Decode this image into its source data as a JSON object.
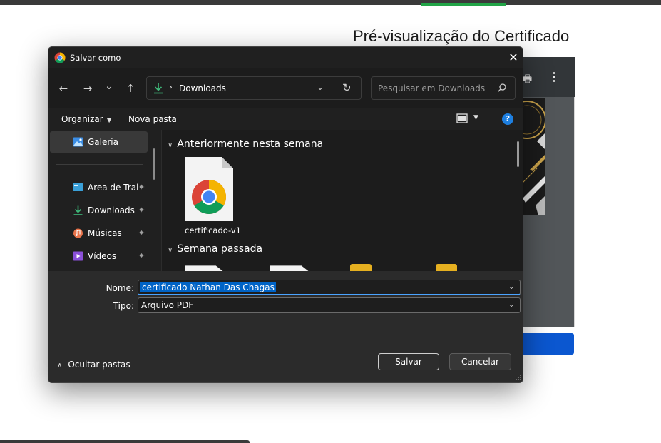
{
  "background_page": {
    "title": "Pré-visualização do Certificado"
  },
  "dialog": {
    "title": "Salvar como",
    "close_symbol": "✕",
    "app_icon": "chrome-icon",
    "nav": {
      "back_symbol": "←",
      "forward_symbol": "→",
      "recent_symbol": "⌄",
      "up_symbol": "↑"
    },
    "address": {
      "separator": "›",
      "location": "Downloads",
      "dropdown_symbol": "⌄",
      "refresh_symbol": "↻"
    },
    "search": {
      "placeholder": "Pesquisar em Downloads"
    },
    "commands": {
      "organize": "Organizar",
      "organize_dd": "▼",
      "new_folder": "Nova pasta",
      "view_dd": "▼",
      "help_symbol": "?"
    },
    "sidebar": {
      "items": [
        {
          "label": "Galeria",
          "icon": "gallery-icon",
          "pinned": false
        },
        {
          "label": "Área de Trabalho",
          "icon": "desktop-icon",
          "pinned": true
        },
        {
          "label": "Downloads",
          "icon": "download-icon",
          "pinned": true
        },
        {
          "label": "Músicas",
          "icon": "music-icon",
          "pinned": true
        },
        {
          "label": "Vídeos",
          "icon": "video-icon",
          "pinned": true
        }
      ],
      "pin_symbol": "📌"
    },
    "content": {
      "groups": [
        {
          "label": "Anteriormente nesta semana",
          "chevron": "∨"
        },
        {
          "label": "Semana passada",
          "chevron": "∨"
        }
      ],
      "files": [
        {
          "name": "certificado-v1",
          "icon": "chrome-file-icon"
        }
      ]
    },
    "form": {
      "name_label": "Nome:",
      "name_value": "certificado Nathan Das Chagas",
      "type_label": "Tipo:",
      "type_value": "Arquivo PDF",
      "dropdown_symbol": "⌄"
    },
    "footer": {
      "hide_folders_chevron": "∧",
      "hide_folders": "Ocultar pastas",
      "save": "Salvar",
      "cancel": "Cancelar"
    }
  },
  "colors": {
    "dialog_bg": "#202020",
    "bottom_bg": "#2b2b2b",
    "accent": "#0063c6",
    "help_blue": "#1e7fe0",
    "page_button_blue": "#0b57d0"
  }
}
